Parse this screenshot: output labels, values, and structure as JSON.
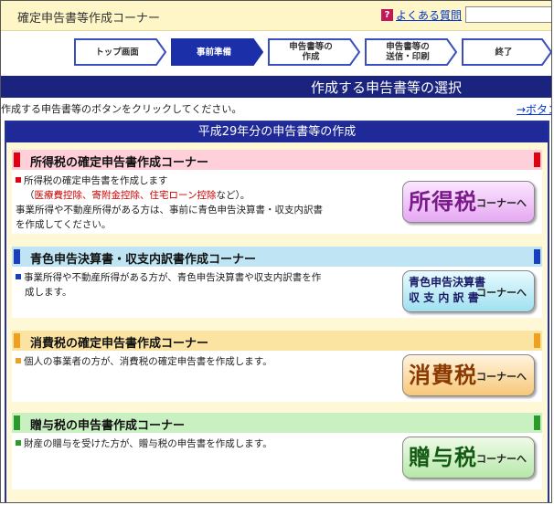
{
  "app_title": "確定申告書等作成コーナー",
  "faq": {
    "icon": "?",
    "label": "よくある質問"
  },
  "steps": [
    {
      "line1": "トップ画面",
      "line2": ""
    },
    {
      "line1": "事前準備",
      "line2": ""
    },
    {
      "line1": "申告書等の",
      "line2": "作成"
    },
    {
      "line1": "申告書等の",
      "line2": "送信・印刷"
    },
    {
      "line1": "終了",
      "line2": ""
    }
  ],
  "banner_title": "作成する申告書等の選択",
  "instruction": "作成する申告書等のボタンをクリックしてください。",
  "instruction_link": "→ボタン",
  "panel_title": "平成29年分の申告書等の作成",
  "colors": {
    "accent_red": "#e00010",
    "accent_blue": "#1a3ec0",
    "accent_orange": "#f0a020",
    "accent_green": "#2a9a2a"
  },
  "sections": [
    {
      "title": "所得税の確定申告書作成コーナー",
      "lines": [
        "所得税の確定申告書を作成します",
        "（",
        "医療費控除、寄附金控除、住宅ローン控除",
        "など）。",
        "事業所得や不動産所得がある方は、事前に青色申告決算書・収支内訳書",
        "を作成してください。"
      ],
      "button": {
        "main": "所得税",
        "sub": "コーナーへ"
      }
    },
    {
      "title": "青色申告決算書・収支内訳書作成コーナー",
      "lines": [
        "事業所得や不動産所得がある方が、青色申告決算書や収支内訳書を作",
        "成します。"
      ],
      "button": {
        "line1": "青色申告決算書",
        "line2": "収 支 内 訳 書",
        "sub": "コーナーへ"
      }
    },
    {
      "title": "消費税の確定申告書作成コーナー",
      "lines": [
        "個人の事業者の方が、消費税の確定申告書を作成します。"
      ],
      "button": {
        "main": "消費税",
        "sub": "コーナーへ"
      }
    },
    {
      "title": "贈与税の申告書作成コーナー",
      "lines": [
        "財産の贈与を受けた方が、贈与税の申告書を作成します。"
      ],
      "button": {
        "main": "贈与税",
        "sub": "コーナーへ"
      }
    }
  ]
}
